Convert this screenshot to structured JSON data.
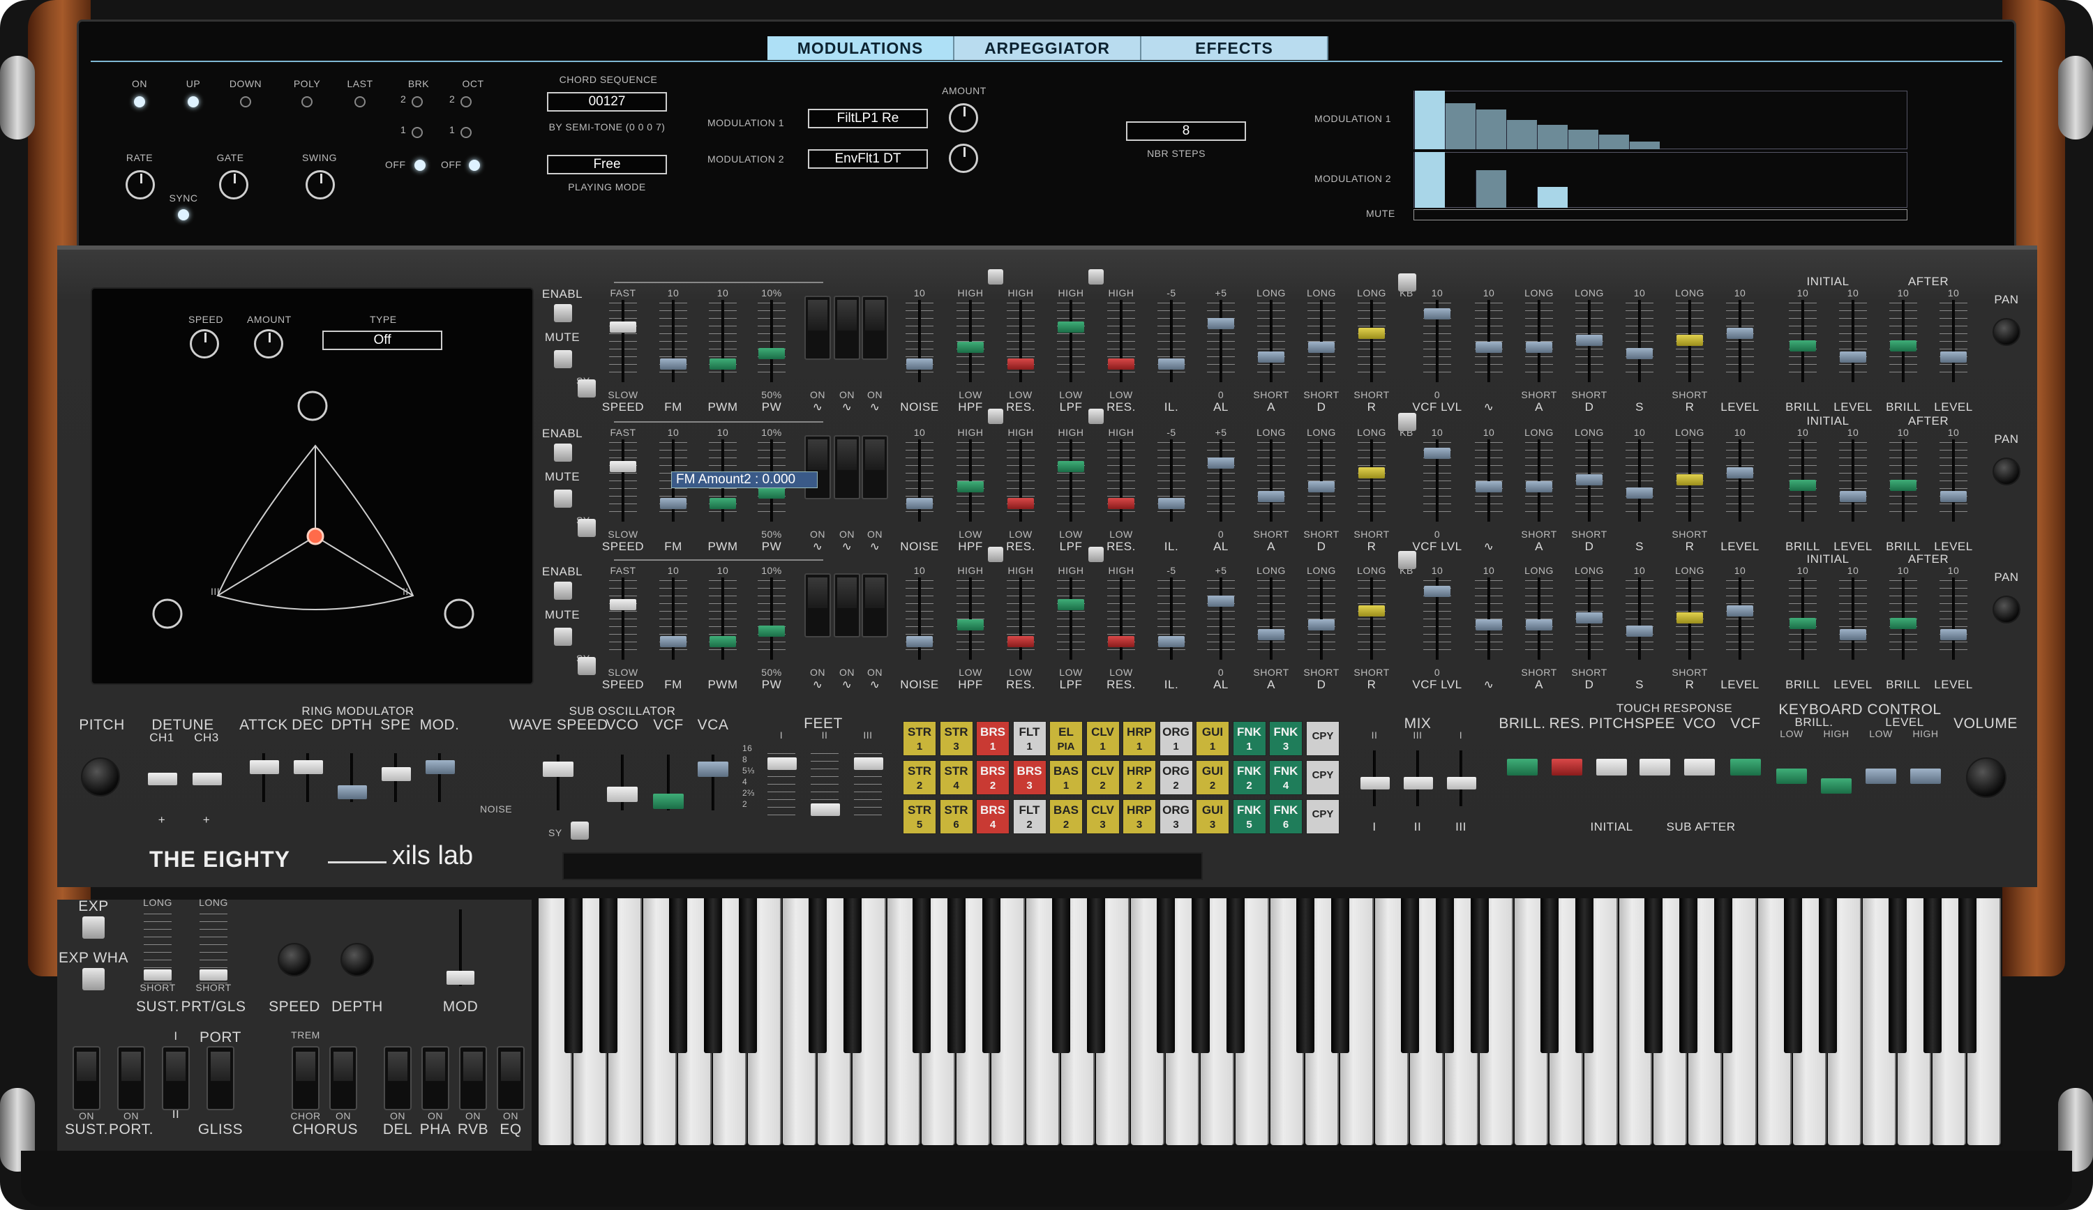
{
  "tabs": [
    "MODULATIONS",
    "ARPEGGIATOR",
    "EFFECTS"
  ],
  "arp": {
    "row1": [
      "ON",
      "UP",
      "DOWN",
      "POLY",
      "LAST",
      "BRK",
      "OCT"
    ],
    "brk_nums": [
      "2",
      "1"
    ],
    "oct_nums": [
      "2",
      "1"
    ],
    "row2": [
      "RATE",
      "GATE",
      "SWING"
    ],
    "sync": "SYNC",
    "off1": "OFF",
    "off2": "OFF",
    "chord_title": "CHORD SEQUENCE",
    "chord_value": "00127",
    "semitone": "BY SEMI-TONE (0 0 0 7)",
    "mode_value": "Free",
    "mode_label": "PLAYING MODE",
    "mod1_label": "MODULATION 1",
    "mod1_value": "FiltLP1 Re",
    "mod2_label": "MODULATION 2",
    "mod2_value": "EnvFlt1 DT",
    "amount": "AMOUNT",
    "steps_value": "8",
    "steps_label": "NBR STEPS",
    "seq_mod1": "MODULATION 1",
    "seq_mod2": "MODULATION 2",
    "mute": "MUTE",
    "mod1_steps": [
      1.0,
      0.78,
      0.68,
      0.5,
      0.42,
      0.33,
      0.25,
      0.13,
      0,
      0,
      0,
      0,
      0,
      0,
      0,
      0
    ],
    "mod2_steps": [
      1.0,
      0,
      0.68,
      0,
      0.38,
      0,
      0,
      0,
      0,
      0,
      0,
      0,
      0,
      0,
      0,
      0
    ]
  },
  "xy": {
    "speed": "SPEED",
    "amount": "AMOUNT",
    "type": "TYPE",
    "type_value": "Off",
    "mark_ii": "II",
    "mark_iii": "III"
  },
  "rows": {
    "enabl": "ENABL",
    "mute": "MUTE",
    "sy": "SY",
    "top_labels": [
      "FAST",
      "10",
      "10",
      "10%",
      "",
      "",
      "",
      "10",
      "HIGH",
      "HIGH",
      "HIGH",
      "HIGH",
      "-5",
      "+5",
      "LONG",
      "LONG",
      "LONG",
      "KB",
      "10",
      "10",
      "LONG",
      "LONG",
      "10",
      "LONG",
      "10"
    ],
    "bottom_top": [
      "SLOW",
      "",
      "",
      "50%",
      "ON",
      "ON",
      "ON",
      "",
      "LOW",
      "LOW",
      "LOW",
      "LOW",
      "",
      "0",
      "SHORT",
      "SHORT",
      "SHORT",
      "",
      "0",
      "",
      "SHORT",
      "SHORT",
      "",
      "SHORT",
      ""
    ],
    "bottom_labels": [
      "SPEED",
      "FM",
      "PWM",
      "PW",
      "∿",
      "∿",
      "∿",
      "NOISE",
      "HPF",
      "RES.",
      "LPF",
      "RES.",
      "IL.",
      "AL",
      "A",
      "D",
      "R",
      "",
      "VCF LVL",
      "∿",
      "A",
      "D",
      "S",
      "R",
      "LEVEL"
    ],
    "initial": "INITIAL",
    "after": "AFTER",
    "right_top": [
      "10",
      "10",
      "10",
      "10"
    ],
    "right_labels": [
      "BRILL",
      "LEVEL",
      "BRILL",
      "LEVEL"
    ],
    "pan": "PAN",
    "tooltip": "FM Amount2 : 0.000"
  },
  "lower": {
    "pitch": "PITCH",
    "detune": "DETUNE",
    "ch1": "CH1",
    "ch3": "CH3",
    "plus": "+",
    "ring": "RING MODULATOR",
    "ring_labels": [
      "ATTCK",
      "DEC",
      "DPTH",
      "SPE",
      "MOD."
    ],
    "sub": "SUB OSCILLATOR",
    "sub_labels": [
      "WAVE SPEED",
      "VCO",
      "VCF",
      "VCA"
    ],
    "noise": "NOISE",
    "sy": "SY",
    "feet": "FEET",
    "feet_marks": [
      "I",
      "II",
      "III"
    ],
    "feet_nums": [
      "16",
      "8",
      "5⅓",
      "4",
      "2⅔",
      "2"
    ],
    "mix": "MIX",
    "mix_marks": [
      "II",
      "III",
      "I"
    ],
    "mix_bottom": [
      "I",
      "II",
      "III"
    ],
    "touch": "TOUCH RESPONSE",
    "touch_labels": [
      "BRILL.",
      "RES.",
      "PITCH",
      "SPEE",
      "VCO",
      "VCF"
    ],
    "initial": "INITIAL",
    "subafter": "SUB AFTER",
    "kbctl": "KEYBOARD CONTROL",
    "kb_labels": [
      "BRILL.",
      "LEVEL"
    ],
    "kb_sub": [
      "LOW",
      "HIGH",
      "LOW",
      "HIGH"
    ],
    "volume": "VOLUME",
    "logo_left": "THE EIGHTY",
    "logo_right": "xils lab",
    "copy": "CPY"
  },
  "presets": [
    [
      {
        "t": "STR",
        "n": "1",
        "c": "y"
      },
      {
        "t": "STR",
        "n": "3",
        "c": "y"
      },
      {
        "t": "BRS",
        "n": "1",
        "c": "r"
      },
      {
        "t": "FLT",
        "n": "1",
        "c": "w"
      },
      {
        "t": "EL",
        "n": "PIA",
        "c": "y"
      },
      {
        "t": "CLV",
        "n": "1",
        "c": "y"
      },
      {
        "t": "HRP",
        "n": "1",
        "c": "y"
      },
      {
        "t": "ORG",
        "n": "1",
        "c": "w"
      },
      {
        "t": "GUI",
        "n": "1",
        "c": "y"
      },
      {
        "t": "FNK",
        "n": "1",
        "c": "g"
      },
      {
        "t": "FNK",
        "n": "3",
        "c": "g"
      }
    ],
    [
      {
        "t": "STR",
        "n": "2",
        "c": "y"
      },
      {
        "t": "STR",
        "n": "4",
        "c": "y"
      },
      {
        "t": "BRS",
        "n": "2",
        "c": "r"
      },
      {
        "t": "BRS",
        "n": "3",
        "c": "r"
      },
      {
        "t": "BAS",
        "n": "1",
        "c": "y"
      },
      {
        "t": "CLV",
        "n": "2",
        "c": "y"
      },
      {
        "t": "HRP",
        "n": "2",
        "c": "y"
      },
      {
        "t": "ORG",
        "n": "2",
        "c": "w"
      },
      {
        "t": "GUI",
        "n": "2",
        "c": "y"
      },
      {
        "t": "FNK",
        "n": "2",
        "c": "g"
      },
      {
        "t": "FNK",
        "n": "4",
        "c": "g"
      }
    ],
    [
      {
        "t": "STR",
        "n": "5",
        "c": "y"
      },
      {
        "t": "STR",
        "n": "6",
        "c": "y"
      },
      {
        "t": "BRS",
        "n": "4",
        "c": "r"
      },
      {
        "t": "FLT",
        "n": "2",
        "c": "w"
      },
      {
        "t": "BAS",
        "n": "2",
        "c": "y"
      },
      {
        "t": "CLV",
        "n": "3",
        "c": "y"
      },
      {
        "t": "HRP",
        "n": "3",
        "c": "y"
      },
      {
        "t": "ORG",
        "n": "3",
        "c": "w"
      },
      {
        "t": "GUI",
        "n": "3",
        "c": "y"
      },
      {
        "t": "FNK",
        "n": "5",
        "c": "g"
      },
      {
        "t": "FNK",
        "n": "6",
        "c": "g"
      }
    ]
  ],
  "perf": {
    "exp": "EXP",
    "expwha": "EXP WHA",
    "long1": "LONG",
    "long2": "LONG",
    "short1": "SHORT",
    "short2": "SHORT",
    "sust": "SUST.",
    "prtgls": "PRT/GLS",
    "speed": "SPEED",
    "depth": "DEPTH",
    "mod": "MOD",
    "port": "PORT",
    "trem": "TREM",
    "i": "I",
    "ii": "II",
    "on_labels": [
      "ON",
      "ON",
      "",
      "",
      "ON",
      "ON",
      "ON",
      "ON",
      "ON"
    ],
    "bottom": [
      "SUST.",
      "PORT.",
      "GLISS",
      "CHORUS",
      "DEL",
      "PHA",
      "RVB",
      "EQ"
    ],
    "chor": "CHOR",
    "on_big": "ON"
  },
  "colors": {
    "screen_accent": "#aee0f6",
    "wood": "#8b4a22",
    "panel": "#2c2c2c"
  }
}
